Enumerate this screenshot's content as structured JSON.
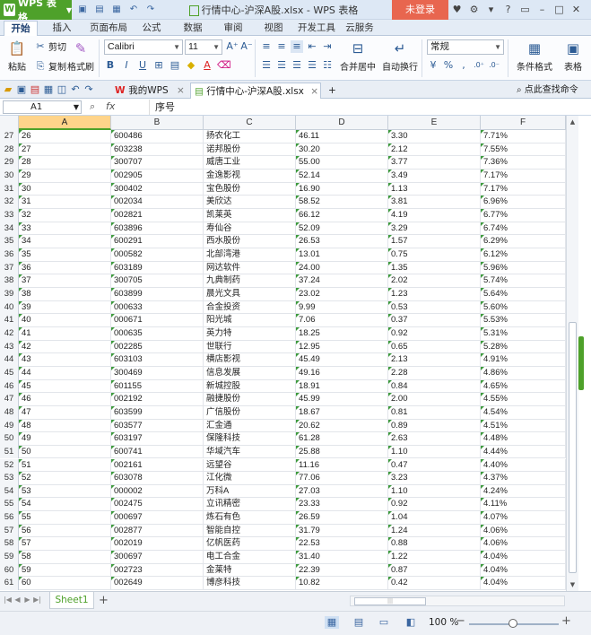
{
  "app": {
    "name": "WPS 表格",
    "title": "行情中心-沪深A股.xlsx - WPS 表格",
    "login": "未登录"
  },
  "ribbon_tabs": [
    "开始",
    "插入",
    "页面布局",
    "公式",
    "数据",
    "审阅",
    "视图",
    "开发工具",
    "云服务"
  ],
  "ribbon": {
    "paste": "粘贴",
    "cut": "剪切",
    "copy": "复制",
    "format_painter": "格式刷",
    "font_name": "Calibri",
    "font_size": "11",
    "merge_center": "合并居中",
    "wrap_text": "自动换行",
    "number_format": "常规",
    "cond_format": "条件格式",
    "table_style": "表格"
  },
  "doc_tabs": {
    "home": "我的WPS",
    "file": "行情中心-沪深A股.xlsx",
    "search": "点此查找命令"
  },
  "formula_bar": {
    "cell_ref": "A1",
    "fx": "fx",
    "content": "序号"
  },
  "columns": [
    "A",
    "B",
    "C",
    "D",
    "E",
    "F"
  ],
  "selected_column": "A",
  "rows": [
    {
      "n": "27",
      "a": "26",
      "b": "600486",
      "c": "扬农化工",
      "d": "46.11",
      "e": "3.30",
      "f": "7.71%"
    },
    {
      "n": "28",
      "a": "27",
      "b": "603238",
      "c": "诺邦股份",
      "d": "30.20",
      "e": "2.12",
      "f": "7.55%"
    },
    {
      "n": "29",
      "a": "28",
      "b": "300707",
      "c": "威唐工业",
      "d": "55.00",
      "e": "3.77",
      "f": "7.36%"
    },
    {
      "n": "30",
      "a": "29",
      "b": "002905",
      "c": "金逸影视",
      "d": "52.14",
      "e": "3.49",
      "f": "7.17%"
    },
    {
      "n": "31",
      "a": "30",
      "b": "300402",
      "c": "宝色股份",
      "d": "16.90",
      "e": "1.13",
      "f": "7.17%"
    },
    {
      "n": "32",
      "a": "31",
      "b": "002034",
      "c": "美欣达",
      "d": "58.52",
      "e": "3.81",
      "f": "6.96%"
    },
    {
      "n": "33",
      "a": "32",
      "b": "002821",
      "c": "凯莱英",
      "d": "66.12",
      "e": "4.19",
      "f": "6.77%"
    },
    {
      "n": "34",
      "a": "33",
      "b": "603896",
      "c": "寿仙谷",
      "d": "52.09",
      "e": "3.29",
      "f": "6.74%"
    },
    {
      "n": "35",
      "a": "34",
      "b": "600291",
      "c": "西水股份",
      "d": "26.53",
      "e": "1.57",
      "f": "6.29%"
    },
    {
      "n": "36",
      "a": "35",
      "b": "000582",
      "c": "北部湾港",
      "d": "13.01",
      "e": "0.75",
      "f": "6.12%"
    },
    {
      "n": "37",
      "a": "36",
      "b": "603189",
      "c": "网达软件",
      "d": "24.00",
      "e": "1.35",
      "f": "5.96%"
    },
    {
      "n": "38",
      "a": "37",
      "b": "300705",
      "c": "九典制药",
      "d": "37.24",
      "e": "2.02",
      "f": "5.74%"
    },
    {
      "n": "39",
      "a": "38",
      "b": "603899",
      "c": "晨光文具",
      "d": "23.02",
      "e": "1.23",
      "f": "5.64%"
    },
    {
      "n": "40",
      "a": "39",
      "b": "000633",
      "c": "合金投资",
      "d": "9.99",
      "e": "0.53",
      "f": "5.60%"
    },
    {
      "n": "41",
      "a": "40",
      "b": "000671",
      "c": "阳光城",
      "d": "7.06",
      "e": "0.37",
      "f": "5.53%"
    },
    {
      "n": "42",
      "a": "41",
      "b": "000635",
      "c": "英力特",
      "d": "18.25",
      "e": "0.92",
      "f": "5.31%"
    },
    {
      "n": "43",
      "a": "42",
      "b": "002285",
      "c": "世联行",
      "d": "12.95",
      "e": "0.65",
      "f": "5.28%"
    },
    {
      "n": "44",
      "a": "43",
      "b": "603103",
      "c": "横店影视",
      "d": "45.49",
      "e": "2.13",
      "f": "4.91%"
    },
    {
      "n": "45",
      "a": "44",
      "b": "300469",
      "c": "信息发展",
      "d": "49.16",
      "e": "2.28",
      "f": "4.86%"
    },
    {
      "n": "46",
      "a": "45",
      "b": "601155",
      "c": "新城控股",
      "d": "18.91",
      "e": "0.84",
      "f": "4.65%"
    },
    {
      "n": "47",
      "a": "46",
      "b": "002192",
      "c": "融捷股份",
      "d": "45.99",
      "e": "2.00",
      "f": "4.55%"
    },
    {
      "n": "48",
      "a": "47",
      "b": "603599",
      "c": "广信股份",
      "d": "18.67",
      "e": "0.81",
      "f": "4.54%"
    },
    {
      "n": "49",
      "a": "48",
      "b": "603577",
      "c": "汇金通",
      "d": "20.62",
      "e": "0.89",
      "f": "4.51%"
    },
    {
      "n": "50",
      "a": "49",
      "b": "603197",
      "c": "保隆科技",
      "d": "61.28",
      "e": "2.63",
      "f": "4.48%"
    },
    {
      "n": "51",
      "a": "50",
      "b": "600741",
      "c": "华域汽车",
      "d": "25.88",
      "e": "1.10",
      "f": "4.44%"
    },
    {
      "n": "52",
      "a": "51",
      "b": "002161",
      "c": "远望谷",
      "d": "11.16",
      "e": "0.47",
      "f": "4.40%"
    },
    {
      "n": "53",
      "a": "52",
      "b": "603078",
      "c": "江化微",
      "d": "77.06",
      "e": "3.23",
      "f": "4.37%"
    },
    {
      "n": "54",
      "a": "53",
      "b": "000002",
      "c": "万科A",
      "d": "27.03",
      "e": "1.10",
      "f": "4.24%"
    },
    {
      "n": "55",
      "a": "54",
      "b": "002475",
      "c": "立讯精密",
      "d": "23.33",
      "e": "0.92",
      "f": "4.11%"
    },
    {
      "n": "56",
      "a": "55",
      "b": "000697",
      "c": "炼石有色",
      "d": "26.59",
      "e": "1.04",
      "f": "4.07%"
    },
    {
      "n": "57",
      "a": "56",
      "b": "002877",
      "c": "智能自控",
      "d": "31.79",
      "e": "1.24",
      "f": "4.06%"
    },
    {
      "n": "58",
      "a": "57",
      "b": "002019",
      "c": "亿帆医药",
      "d": "22.53",
      "e": "0.88",
      "f": "4.06%"
    },
    {
      "n": "59",
      "a": "58",
      "b": "300697",
      "c": "电工合金",
      "d": "31.40",
      "e": "1.22",
      "f": "4.04%"
    },
    {
      "n": "60",
      "a": "59",
      "b": "002723",
      "c": "金莱特",
      "d": "22.39",
      "e": "0.87",
      "f": "4.04%"
    },
    {
      "n": "61",
      "a": "60",
      "b": "002649",
      "c": "博彦科技",
      "d": "10.82",
      "e": "0.42",
      "f": "4.04%"
    }
  ],
  "sheet_tab": "Sheet1",
  "status": {
    "zoom": "100 %"
  },
  "colors": {
    "accent_green": "#4ea12a",
    "login_red": "#e8664f",
    "selected_col": "#ffd48a"
  }
}
